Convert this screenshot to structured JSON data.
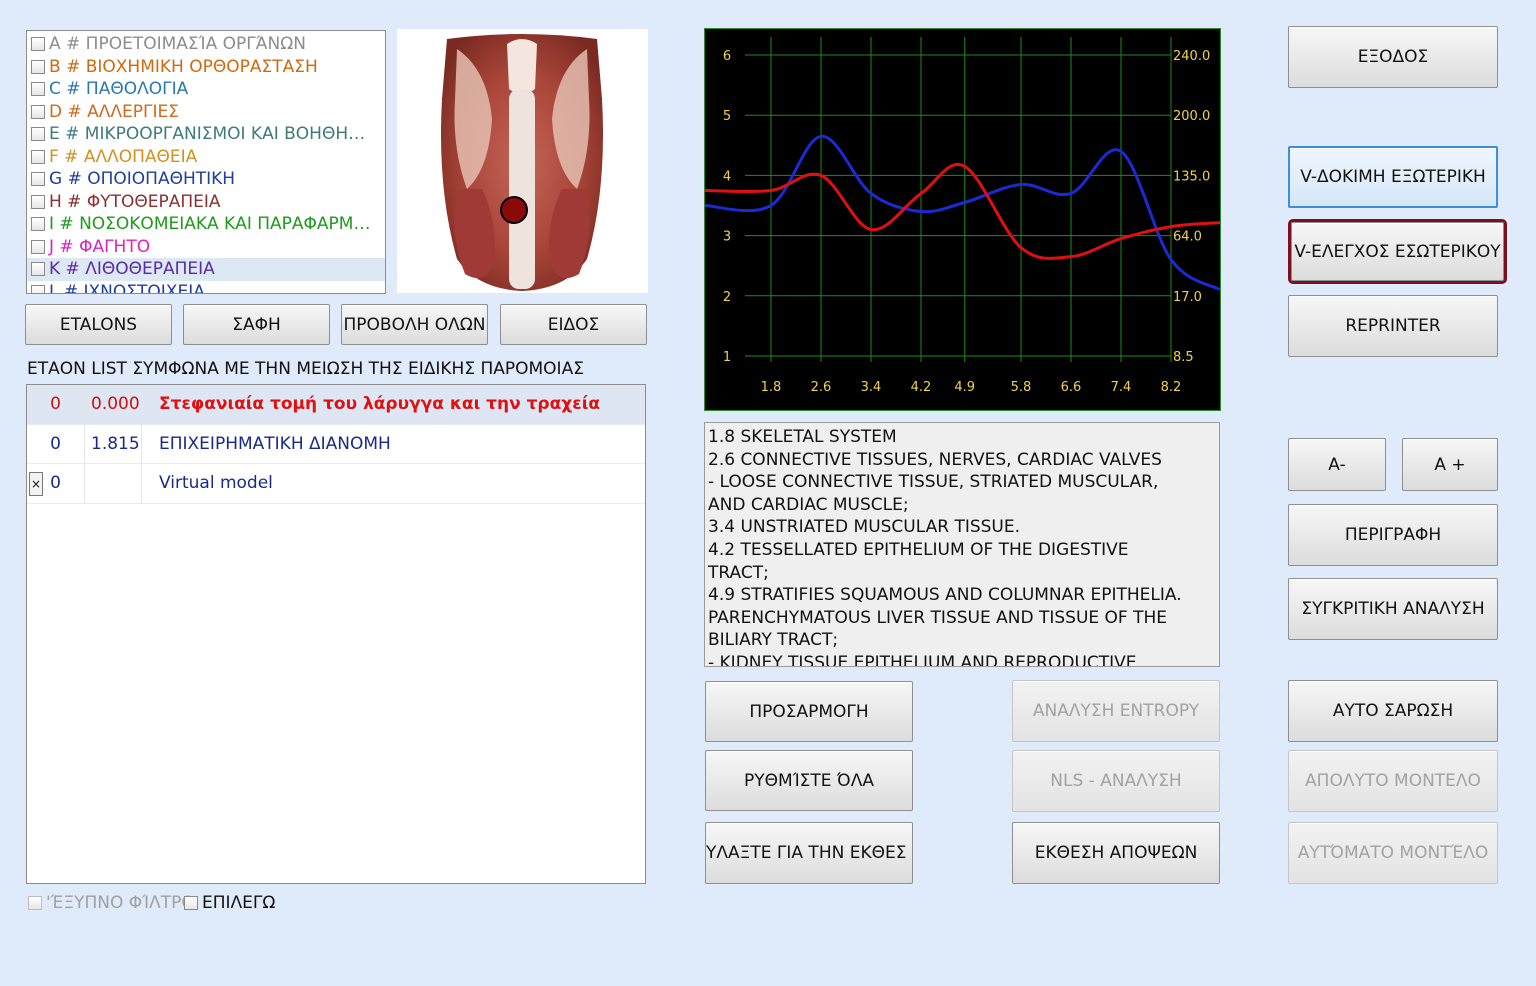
{
  "categories": [
    {
      "label": "A # ΠΡΟΕΤΟΙΜΑΣΊΑ ΟΡΓΆΝΩΝ",
      "color": "#8c8c8c"
    },
    {
      "label": "B # ΒΙΟΧΗΜΙΚΗ ΟΡΘΟΡΑΣΤΑΣΗ",
      "color": "#d06a10"
    },
    {
      "label": "C # ΠΑΘΟΛΟΓΙΑ",
      "color": "#2b78b0"
    },
    {
      "label": "D # ΑΛΛΕΡΓΙΕΣ",
      "color": "#d2691e"
    },
    {
      "label": "E # ΜΙΚΡΟΟΡΓΑΝΙΣΜΟΙ ΚΑΙ ΒΟΗΘΗ…",
      "color": "#3f7a7a"
    },
    {
      "label": "F # ΑΛΛΟΠΑΘΕΙΑ",
      "color": "#d2901e"
    },
    {
      "label": "G # ΟΠΟΙΟΠΑΘΗΤΙΚΗ",
      "color": "#1e3ea0"
    },
    {
      "label": "H # ΦΥΤΟΘΕΡΑΠΕΙΑ",
      "color": "#8a3030"
    },
    {
      "label": "I # ΝΟΣΟΚΟΜΕΙΑΚΑ ΚΑΙ ΠΑΡΑΦΑΡΜ…",
      "color": "#1e9a1e"
    },
    {
      "label": "J # ΦΑΓΗΤΟ",
      "color": "#e020c0"
    },
    {
      "label": "K # ΛΙΘΟΘΕΡΑΠΕΙΑ",
      "color": "#5a2aa0"
    },
    {
      "label": "L # ΙΧΝΟΣΤΟΙΧΕΙΑ",
      "color": "#1e3ea0"
    }
  ],
  "buttons": {
    "etalons": "ETALONS",
    "saphe": "ΣΑΦΗ",
    "show_all": "ΠΡΟΒΟΛΗ ΟΛΩΝ",
    "type": "ΕΙΔΟΣ",
    "exit": "ΕΞΟΔΟΣ",
    "v_test_external": "V-ΔΟΚΙΜΗ ΕΞΩΤΕΡΙΚΗ",
    "v_check_internal": "V-ΕΛΕΓΧΟΣ ΕΣΩΤΕΡΙΚΟΥ",
    "reprinter": "REPRINTER",
    "a_minus": "A-",
    "a_plus": "A +",
    "description": "ΠΕΡΙΓΡΑΦΗ",
    "comparative": "ΣΥΓΚΡΙΤΙΚΗ ΑΝΑΛΥΣΗ",
    "adjust": "ΠΡΟΣΑΡΜΟΓΗ",
    "entropy": "ΑΝΑΛΥΣΗ ENTROPY",
    "auto_scan": "ΑΥΤΟ ΣΑΡΩΣΗ",
    "set_all": "ΡΥΘΜΊΣΤΕ ΌΛΑ",
    "nls": "NLS - ΑΝΑΛΥΣΗ",
    "absolute_model": "ΑΠΟΛΥΤΟ ΜΟΝΤΕΛΟ",
    "save_report": "ΥΛΑΞΤΕ ΓΙΑ ΤΗΝ ΕΚΘΕΣ",
    "opinion_report": "ΕΚΘΕΣΗ ΑΠΟΨΕΩΝ",
    "auto_model": "ΑΥΤΌΜΑΤΟ ΜΟΝΤΈΛΟ"
  },
  "etalon_heading": "ΕΤΑΟΝ LIST ΣΥΜΦΩΝΑ ΜΕ ΤΗΝ ΜΕΙΩΣΗ ΤΗΣ ΕΙΔΙΚΗΣ ΠΑΡΟΜΟΙΑΣ",
  "etalon_rows": [
    {
      "idx": "0",
      "value": "0.000",
      "name": "Στεφανιαία τομή του λάρυγγα και την τραχεία",
      "idx_color": "#d01010",
      "value_color": "#d01010",
      "name_color": "#e01010",
      "bold": true
    },
    {
      "idx": "0",
      "value": "1.815",
      "name": "ΕΠΙΧΕΙΡΗΜΑΤΙΚΗ ΔΙΑΝΟΜΗ",
      "idx_color": "#1a2a8a",
      "value_color": "#1a2a8a",
      "name_color": "#1a2a8a",
      "bold": false
    },
    {
      "idx": "0",
      "value": "",
      "name": "Virtual model",
      "idx_color": "#1a2a8a",
      "value_color": "#1a2a8a",
      "name_color": "#1a2a8a",
      "bold": false,
      "close": "×"
    }
  ],
  "checkboxes": {
    "smart_filter": "'ΈΞΥΠΝΟ ΦΊΛΤΡΟ",
    "select": "ΕΠΙΛΕΓΩ"
  },
  "description_lines": [
    "1.8 SKELETAL SYSTEM",
    "2.6 CONNECTIVE TISSUES, NERVES, CARDIAC VALVES",
    "- LOOSE CONNECTIVE TISSUE, STRIATED MUSCULAR,",
    "AND CARDIAC MUSCLE;",
    "3.4 UNSTRIATED MUSCULAR TISSUE.",
    "4.2 TESSELLATED EPITHELIUM OF THE DIGESTIVE",
    "TRACT;",
    "4.9 STRATIFIES SQUAMOUS AND COLUMNAR EPITHELIA.",
    "PARENCHYMATOUS LIVER TISSUE AND TISSUE OF THE",
    "BILIARY TRACT;",
    "- KIDNEY TISSUE EPITHELIUM AND REPRODUCTIVE"
  ],
  "chart_data": {
    "type": "line",
    "x_ticks": [
      "1.8",
      "2.6",
      "3.4",
      "4.2",
      "4.9",
      "5.8",
      "6.6",
      "7.4",
      "8.2"
    ],
    "y_left_ticks": [
      "1",
      "2",
      "3",
      "4",
      "5",
      "6"
    ],
    "y_right_ticks": [
      "8.5",
      "17.0",
      "64.0",
      "135.0",
      "200.0",
      "240.0"
    ],
    "x": [
      1.8,
      2.6,
      3.4,
      4.2,
      4.9,
      5.8,
      6.6,
      7.4,
      8.2
    ],
    "ylim": [
      0.9,
      6.3
    ],
    "grid": true,
    "series": [
      {
        "color": "#1a2bd6",
        "values": [
          3.5,
          4.65,
          3.7,
          3.4,
          3.55,
          3.85,
          3.7,
          4.4,
          2.6
        ]
      },
      {
        "color": "#e01010",
        "values": [
          3.75,
          4.0,
          3.1,
          3.7,
          4.15,
          2.8,
          2.65,
          2.95,
          3.15
        ]
      }
    ],
    "background": "#000000",
    "grid_color": "#1f8a1f",
    "label_color": "#f2d24a"
  }
}
